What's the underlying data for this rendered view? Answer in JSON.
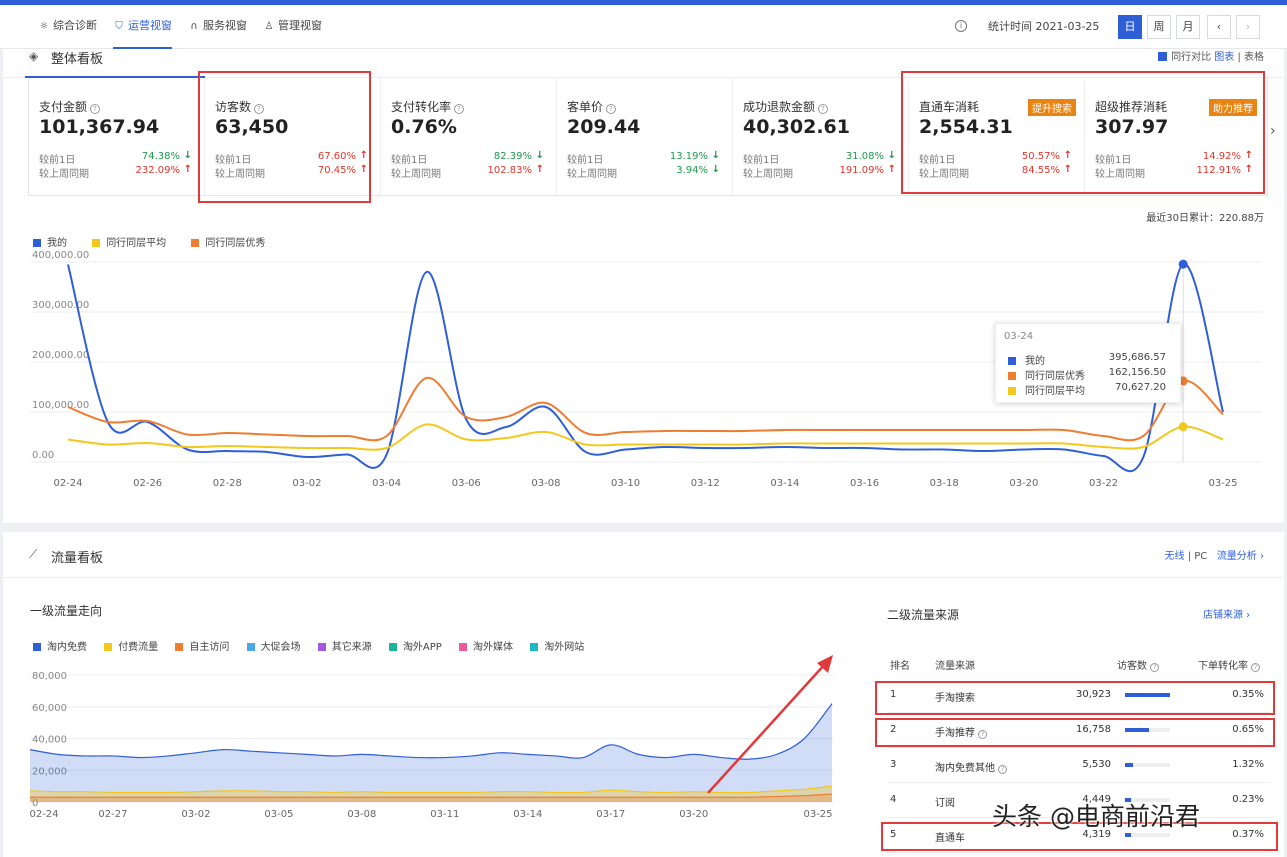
{
  "nav": {
    "tabs": [
      {
        "label": "综合诊断",
        "icon": "bulb-icon"
      },
      {
        "label": "运营视窗",
        "icon": "shield-icon"
      },
      {
        "label": "服务视窗",
        "icon": "headset-icon"
      },
      {
        "label": "管理视窗",
        "icon": "user-icon"
      }
    ],
    "active_tab": "运营视窗",
    "stat_label": "统计时间 2021-03-25",
    "period_buttons": [
      "日",
      "周",
      "月"
    ],
    "active_period": "日",
    "prev": "‹",
    "next": "›"
  },
  "overview": {
    "title": "整体看板",
    "compare_label": "同行对比",
    "view_chart": "图表",
    "view_table": "表格",
    "kpis": [
      {
        "name": "支付金额",
        "value": "101,367.94",
        "l1": "较前1日",
        "v1": "74.38%",
        "d1": "down",
        "l2": "较上周同期",
        "v2": "232.09%",
        "d2": "up",
        "badge": ""
      },
      {
        "name": "访客数",
        "value": "63,450",
        "l1": "较前1日",
        "v1": "67.60%",
        "d1": "up",
        "l2": "较上周同期",
        "v2": "70.45%",
        "d2": "up",
        "badge": ""
      },
      {
        "name": "支付转化率",
        "value": "0.76%",
        "l1": "较前1日",
        "v1": "82.39%",
        "d1": "down",
        "l2": "较上周同期",
        "v2": "102.83%",
        "d2": "up",
        "badge": ""
      },
      {
        "name": "客单价",
        "value": "209.44",
        "l1": "较前1日",
        "v1": "13.19%",
        "d1": "down",
        "l2": "较上周同期",
        "v2": "3.94%",
        "d2": "down",
        "badge": ""
      },
      {
        "name": "成功退款金额",
        "value": "40,302.61",
        "l1": "较前1日",
        "v1": "31.08%",
        "d1": "down",
        "l2": "较上周同期",
        "v2": "191.09%",
        "d2": "up",
        "badge": ""
      },
      {
        "name": "直通车消耗",
        "value": "2,554.31",
        "l1": "较前1日",
        "v1": "50.57%",
        "d1": "up",
        "l2": "较上周同期",
        "v2": "84.55%",
        "d2": "up",
        "badge": "提升搜索"
      },
      {
        "name": "超级推荐消耗",
        "value": "307.97",
        "l1": "较前1日",
        "v1": "14.92%",
        "d1": "up",
        "l2": "较上周同期",
        "v2": "112.91%",
        "d2": "up",
        "badge": "助力推荐"
      }
    ],
    "total_label": "最近30日累计：220.88万",
    "tooltip": {
      "date": "03-24",
      "rows": [
        {
          "label": "我的",
          "value": "395,686.57",
          "color": "#2f5fd6"
        },
        {
          "label": "同行同层优秀",
          "value": "162,156.50",
          "color": "#ef7d31"
        },
        {
          "label": "同行同层平均",
          "value": "70,627.20",
          "color": "#f2c81f"
        }
      ]
    }
  },
  "traffic": {
    "title": "流量看板",
    "right_wireless": "无线",
    "right_pc": "PC",
    "right_link": "流量分析 ›",
    "sub_left": "一级流量走向",
    "sub_right": "二级流量来源",
    "sub_right_link": "店铺来源 ›",
    "table_headers": [
      "排名",
      "流量来源",
      "访客数",
      "下单转化率"
    ],
    "table_rows": [
      {
        "rank": "1",
        "source": "手淘搜索",
        "visitors": "30,923",
        "bar": 1.0,
        "conv": "0.35%",
        "help": false
      },
      {
        "rank": "2",
        "source": "手淘推荐",
        "visitors": "16,758",
        "bar": 0.54,
        "conv": "0.65%",
        "help": true
      },
      {
        "rank": "3",
        "source": "淘内免费其他",
        "visitors": "5,530",
        "bar": 0.18,
        "conv": "1.32%",
        "help": true
      },
      {
        "rank": "4",
        "source": "订阅",
        "visitors": "4,449",
        "bar": 0.14,
        "conv": "0.23%",
        "help": false
      },
      {
        "rank": "5",
        "source": "直通车",
        "visitors": "4,319",
        "bar": 0.14,
        "conv": "0.37%",
        "help": false
      }
    ]
  },
  "watermark": "头条 @电商前沿君",
  "chart_data": [
    {
      "type": "line",
      "x": [
        "02-24",
        "02-25",
        "02-26",
        "02-27",
        "02-28",
        "03-01",
        "03-02",
        "03-03",
        "03-04",
        "03-05",
        "03-06",
        "03-07",
        "03-08",
        "03-09",
        "03-10",
        "03-11",
        "03-12",
        "03-13",
        "03-14",
        "03-15",
        "03-16",
        "03-17",
        "03-18",
        "03-19",
        "03-20",
        "03-21",
        "03-22",
        "03-23",
        "03-24",
        "03-25"
      ],
      "xticks": [
        "02-24",
        "02-26",
        "02-28",
        "03-02",
        "03-04",
        "03-06",
        "03-08",
        "03-10",
        "03-12",
        "03-14",
        "03-16",
        "03-18",
        "03-20",
        "03-22",
        "03-25"
      ],
      "yticks": [
        "0.00",
        "100,000.00",
        "200,000.00",
        "300,000.00",
        "400,000.00"
      ],
      "ylim": [
        0,
        400000
      ],
      "legend": "top-left",
      "series": [
        {
          "name": "我的",
          "color": "#2f5fd6",
          "values": [
            395000,
            80000,
            80000,
            25000,
            22000,
            20000,
            10000,
            15000,
            15000,
            380000,
            85000,
            70000,
            110000,
            20000,
            25000,
            30000,
            28000,
            28000,
            30000,
            28000,
            28000,
            25000,
            25000,
            22000,
            25000,
            25000,
            12000,
            10000,
            395686.57,
            100000
          ]
        },
        {
          "name": "同行同层平均",
          "color": "#f2c81f",
          "values": [
            45000,
            35000,
            38000,
            30000,
            32000,
            30000,
            28000,
            28000,
            28000,
            75000,
            45000,
            48000,
            60000,
            35000,
            35000,
            35000,
            35000,
            35000,
            37000,
            37000,
            37000,
            37000,
            37000,
            37000,
            37000,
            37000,
            30000,
            30000,
            70627.2,
            45000
          ]
        },
        {
          "name": "同行同层优秀",
          "color": "#ef7d31",
          "values": [
            110000,
            80000,
            82000,
            55000,
            58000,
            55000,
            52000,
            52000,
            52000,
            168000,
            90000,
            90000,
            118000,
            58000,
            60000,
            62000,
            62000,
            62000,
            64000,
            64000,
            64000,
            64000,
            64000,
            64000,
            64000,
            64000,
            52000,
            52000,
            162156.5,
            95000
          ]
        }
      ]
    },
    {
      "type": "area",
      "x": [
        "02-24",
        "02-25",
        "02-26",
        "02-27",
        "02-28",
        "03-01",
        "03-02",
        "03-03",
        "03-04",
        "03-05",
        "03-06",
        "03-07",
        "03-08",
        "03-09",
        "03-10",
        "03-11",
        "03-12",
        "03-13",
        "03-14",
        "03-15",
        "03-16",
        "03-17",
        "03-18",
        "03-19",
        "03-20",
        "03-21",
        "03-22",
        "03-23",
        "03-24",
        "03-25"
      ],
      "xticks": [
        "02-24",
        "02-27",
        "03-02",
        "03-05",
        "03-08",
        "03-11",
        "03-14",
        "03-17",
        "03-20",
        "03-25"
      ],
      "yticks": [
        "0",
        "20,000",
        "40,000",
        "60,000",
        "80,000"
      ],
      "ylim": [
        0,
        80000
      ],
      "legend": "top-left",
      "series": [
        {
          "name": "淘内免费",
          "color": "#2f5fd6",
          "values": [
            33000,
            30000,
            29000,
            29000,
            28000,
            29000,
            31000,
            33000,
            32000,
            31000,
            30000,
            29000,
            30000,
            29000,
            28000,
            28000,
            29000,
            31000,
            30000,
            29000,
            28000,
            36000,
            30000,
            28000,
            30000,
            28000,
            27000,
            30000,
            40000,
            62000
          ]
        },
        {
          "name": "付费流量",
          "color": "#f2c81f",
          "values": [
            7000,
            6500,
            6500,
            6000,
            6000,
            6000,
            6500,
            7000,
            7000,
            6500,
            6500,
            6000,
            6500,
            6000,
            6000,
            6000,
            6000,
            6500,
            6500,
            6000,
            6000,
            7500,
            6500,
            6000,
            6500,
            6000,
            6000,
            7000,
            8000,
            10000
          ]
        },
        {
          "name": "自主访问",
          "color": "#ef7d31",
          "values": [
            3000,
            3000,
            3000,
            3000,
            3000,
            3000,
            3000,
            3000,
            3000,
            3000,
            3000,
            3000,
            3000,
            3000,
            3000,
            3000,
            3000,
            3000,
            3000,
            3000,
            3000,
            3000,
            3000,
            3000,
            3000,
            3000,
            3000,
            3500,
            4000,
            5000
          ]
        },
        {
          "name": "大促会场",
          "color": "#4aa8e8",
          "values": []
        },
        {
          "name": "其它来源",
          "color": "#a65ad9",
          "values": []
        },
        {
          "name": "淘外APP",
          "color": "#1ab49a",
          "values": []
        },
        {
          "name": "淘外媒体",
          "color": "#e85c9d",
          "values": []
        },
        {
          "name": "淘外网站",
          "color": "#1dbcc4",
          "values": []
        }
      ]
    }
  ]
}
